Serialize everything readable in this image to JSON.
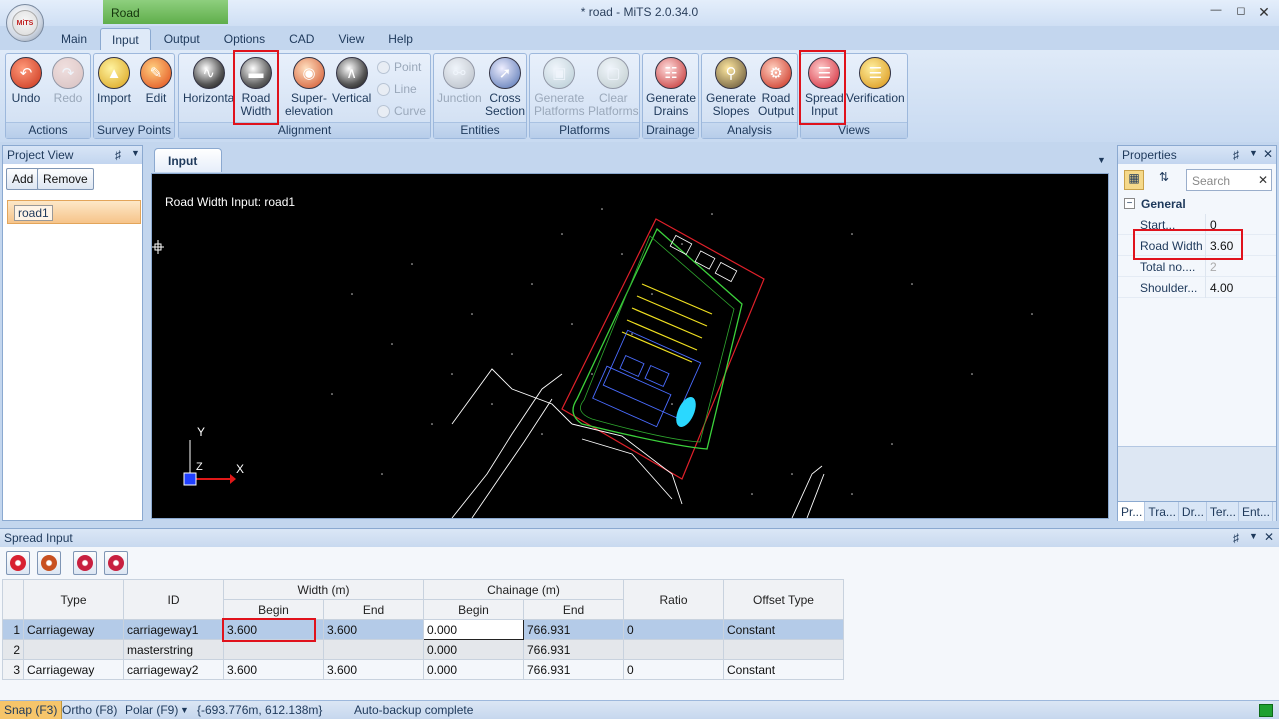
{
  "window": {
    "title": "* road - MiTS 2.0.34.0",
    "context_tab": "Road",
    "logo_text": "MiTS"
  },
  "menu": {
    "tabs": [
      "Main",
      "Input",
      "Output",
      "Options",
      "CAD",
      "View",
      "Help"
    ],
    "active": "Input"
  },
  "ribbon": {
    "actions": {
      "label": "Actions",
      "undo": "Undo",
      "redo": "Redo"
    },
    "survey_points": {
      "label": "Survey Points",
      "import": "Import",
      "edit": "Edit"
    },
    "alignment": {
      "label": "Alignment",
      "horizontal": "Horizonta",
      "road_width": [
        "Road",
        "Width"
      ],
      "super": [
        "Super-",
        "elevation"
      ],
      "vertical": "Vertical",
      "point": "Point",
      "line": "Line",
      "curve": "Curve"
    },
    "entities": {
      "label": "Entities",
      "junction": "Junction",
      "cross_section": [
        "Cross",
        "Section"
      ]
    },
    "platforms": {
      "label": "Platforms",
      "generate": [
        "Generate",
        "Platforms"
      ],
      "clear": [
        "Clear",
        "Platforms"
      ]
    },
    "drainage": {
      "label": "Drainage",
      "generate": [
        "Generate",
        "Drains"
      ]
    },
    "analysis": {
      "label": "Analysis",
      "slopes": [
        "Generate",
        "Slopes"
      ],
      "output": [
        "Road",
        "Output"
      ]
    },
    "views": {
      "label": "Views",
      "spread": [
        "Spread",
        "Input"
      ],
      "verification": "Verification"
    }
  },
  "project_view": {
    "title": "Project View",
    "add": "Add",
    "remove": "Remove",
    "item": "road1"
  },
  "document": {
    "tab": "Input",
    "canvas_title": "Road Width Input: road1",
    "axis_y": "Y",
    "axis_x": "X",
    "axis_z": "Z"
  },
  "properties": {
    "title": "Properties",
    "search_placeholder": "Search",
    "category": "General",
    "rows": [
      {
        "key": "Start...",
        "value": "0"
      },
      {
        "key": "Road Width",
        "value": "3.60"
      },
      {
        "key": "Total no....",
        "value": "2"
      },
      {
        "key": "Shoulder...",
        "value": "4.00"
      }
    ],
    "bottom_tabs": [
      "Pr...",
      "Tra...",
      "Dr...",
      "Ter...",
      "Ent..."
    ]
  },
  "spread_input": {
    "title": "Spread Input",
    "headers": {
      "type": "Type",
      "id": "ID",
      "width": "Width (m)",
      "chainage": "Chainage (m)",
      "begin": "Begin",
      "end": "End",
      "ratio": "Ratio",
      "offset_type": "Offset Type"
    },
    "rows": [
      {
        "n": "1",
        "type": "Carriageway",
        "id": "carriageway1",
        "wb": "3.600",
        "we": "3.600",
        "cb": "0.000",
        "ce": "766.931",
        "ratio": "0",
        "offset": "Constant"
      },
      {
        "n": "2",
        "type": "",
        "id": "masterstring",
        "wb": "",
        "we": "",
        "cb": "0.000",
        "ce": "766.931",
        "ratio": "",
        "offset": ""
      },
      {
        "n": "3",
        "type": "Carriageway",
        "id": "carriageway2",
        "wb": "3.600",
        "we": "3.600",
        "cb": "0.000",
        "ce": "766.931",
        "ratio": "0",
        "offset": "Constant"
      }
    ]
  },
  "status": {
    "snap": "Snap (F3)",
    "ortho": "Ortho (F8)",
    "polar": "Polar (F9)",
    "coords": "{-693.776m, 612.138m}",
    "message": "Auto-backup complete"
  }
}
